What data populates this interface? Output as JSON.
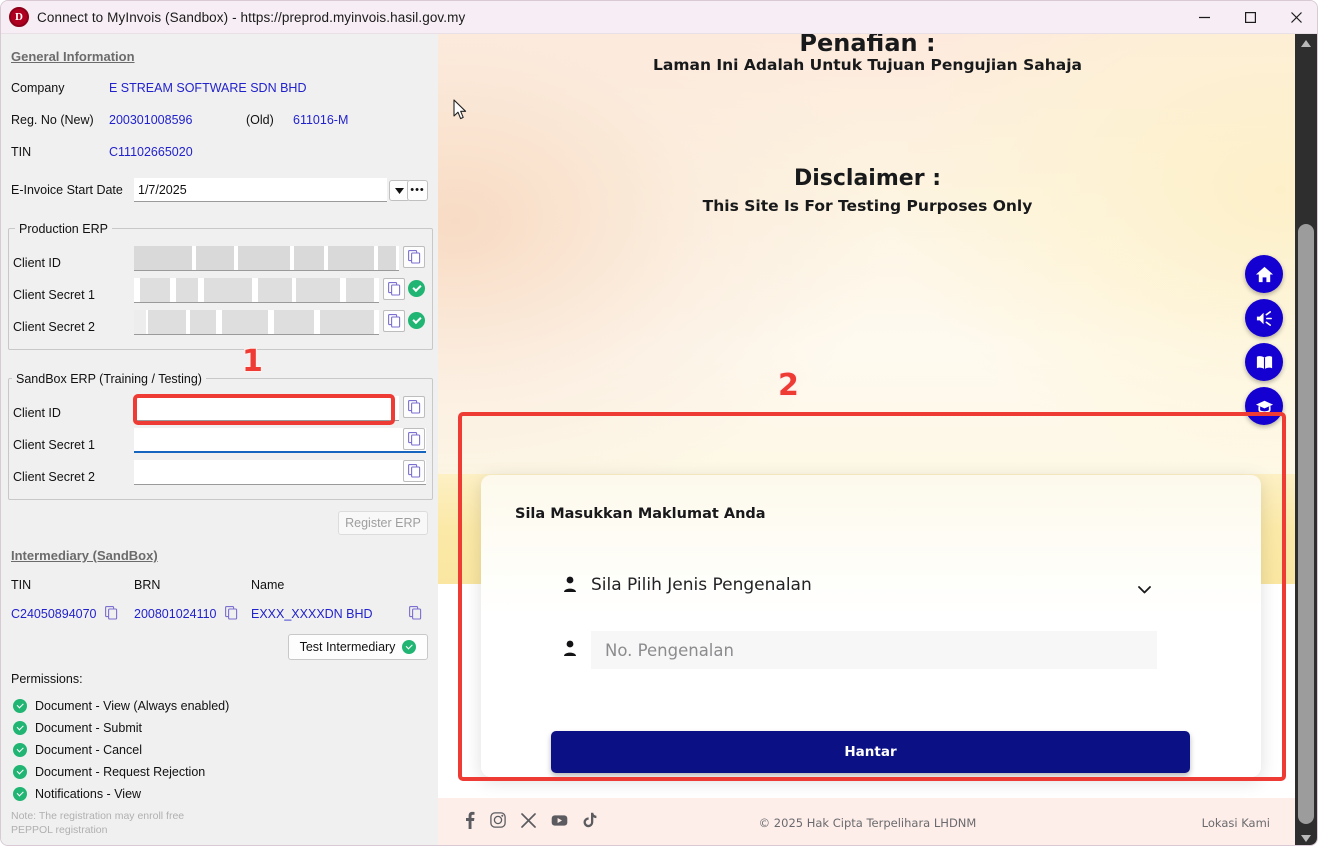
{
  "window": {
    "title": "Connect to MyInvois (Sandbox) - https://preprod.myinvois.hasil.gov.my",
    "logo_letter": "D",
    "minimize_label": "–",
    "maximize_label": "☐",
    "close_label": "✕"
  },
  "general": {
    "heading": "General Information",
    "company_label": "Company",
    "company_value": "E STREAM SOFTWARE SDN BHD",
    "regno_label": "Reg. No (New)",
    "regno_value": "200301008596",
    "regno_old_label": "(Old)",
    "regno_old_value": "611016-M",
    "tin_label": "TIN",
    "tin_value": "C11102665020",
    "start_date_label": "E-Invoice Start Date",
    "start_date_value": "1/7/2025",
    "dropdown_icon": "chevron-down-icon",
    "ellipsis_label": "•••"
  },
  "production_erp": {
    "group_title": "Production ERP",
    "client_id_label": "Client ID",
    "client_secret1_label": "Client Secret 1",
    "client_secret2_label": "Client Secret 2",
    "client_id_value": "",
    "client_secret1_value": "",
    "client_secret2_value": "",
    "copy_icon": "copy-icon",
    "verified_icon": "check-circle-icon"
  },
  "sandbox_erp": {
    "group_title": "SandBox ERP (Training / Testing)",
    "client_id_label": "Client ID",
    "client_secret1_label": "Client Secret 1",
    "client_secret2_label": "Client Secret 2",
    "client_id_value": "",
    "client_secret1_value": "",
    "client_secret2_value": "",
    "copy_icon": "copy-icon"
  },
  "register_erp": {
    "label": "Register ERP",
    "enabled": false
  },
  "intermediary": {
    "heading": "Intermediary (SandBox)",
    "columns": [
      "TIN",
      "BRN",
      "Name"
    ],
    "row": {
      "tin": "C24050894070",
      "brn": "200801024110",
      "name": "EXXX_XXXXDN BHD"
    },
    "copy_icon": "copy-icon",
    "test_button_label": "Test Intermediary",
    "test_button_status_icon": "check-circle-icon"
  },
  "permissions": {
    "heading": "Permissions:",
    "items": [
      "Document - View (Always enabled)",
      "Document - Submit",
      "Document - Cancel",
      "Document - Request Rejection",
      "Notifications - View"
    ],
    "status_icon": "check-circle-icon"
  },
  "footer_note": "Note: The registration may enroll free\nPEPPOL registration",
  "webpage": {
    "disclaimer_bm_title": "Penafian :",
    "disclaimer_bm_text": "Laman Ini Adalah Untuk Tujuan Pengujian Sahaja",
    "disclaimer_en_title": "Disclaimer :",
    "disclaimer_en_text": "This Site Is For Testing Purposes Only",
    "fabs": [
      {
        "name": "home-icon",
        "label": "Home"
      },
      {
        "name": "megaphone-icon",
        "label": "Announcements"
      },
      {
        "name": "book-icon",
        "label": "Guide"
      },
      {
        "name": "graduation-cap-icon",
        "label": "Learning"
      }
    ],
    "login_card": {
      "title": "Sila Masukkan Maklumat Anda",
      "id_type_placeholder": "Sila Pilih Jenis Pengenalan",
      "id_type_value": "",
      "id_number_placeholder": "No. Pengenalan",
      "id_number_value": "",
      "submit_label": "Hantar",
      "person_icon": "person-icon",
      "chevron_icon": "chevron-down-icon"
    },
    "footer": {
      "social": [
        "facebook-icon",
        "instagram-icon",
        "x-icon",
        "youtube-icon",
        "tiktok-icon"
      ],
      "copyright": "© 2025 Hak Cipta Terpelihara LHDNM",
      "location_link": "Lokasi Kami"
    }
  },
  "annotations": {
    "one": "1",
    "two": "2",
    "color": "#ee3b33"
  },
  "colors": {
    "accent_blue": "#2222cc",
    "submit_blue": "#0b1184",
    "fab_blue": "#1400d1",
    "success_green": "#21b573",
    "annotation_red": "#ee3b33",
    "panel_bg": "#f0f0f0"
  }
}
